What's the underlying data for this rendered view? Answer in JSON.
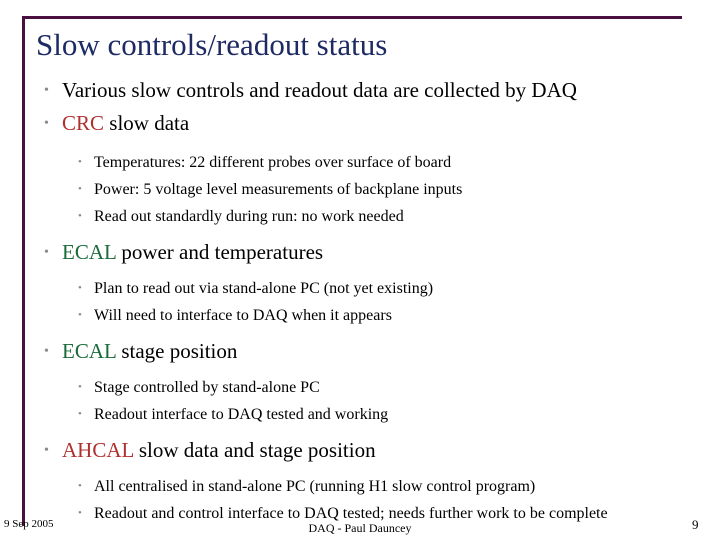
{
  "slide": {
    "title": "Slow controls/readout status",
    "accent_border_color": "#4a1040",
    "title_color": "#1d2a63",
    "highlight_red": "#b03030",
    "highlight_green": "#1b6b3a",
    "bullet_glyph": "•",
    "content": [
      {
        "level": 1,
        "text": "Various slow controls and readout data are collected by DAQ",
        "highlight": null
      },
      {
        "level": 1,
        "highlight": "CRC",
        "highlight_color": "#b03030",
        "text": " slow data"
      },
      {
        "level": 2,
        "text": "Temperatures: 22 different probes over surface of board"
      },
      {
        "level": 2,
        "text": "Power: 5 voltage level measurements of backplane inputs"
      },
      {
        "level": 2,
        "text": "Read out standardly during run: no work needed"
      },
      {
        "level": 1,
        "highlight": "ECAL",
        "highlight_color": "#1b6b3a",
        "text": " power and temperatures"
      },
      {
        "level": 2,
        "text": "Plan to read out via stand-alone PC (not yet existing)"
      },
      {
        "level": 2,
        "text": "Will need to interface to DAQ when it appears"
      },
      {
        "level": 1,
        "highlight": "ECAL",
        "highlight_color": "#1b6b3a",
        "text": " stage position"
      },
      {
        "level": 2,
        "text": "Stage controlled by stand-alone PC"
      },
      {
        "level": 2,
        "text": "Readout interface to DAQ tested and working"
      },
      {
        "level": 1,
        "highlight": "AHCAL",
        "highlight_color": "#b03030",
        "text": " slow data and stage position"
      },
      {
        "level": 2,
        "text": "All centralised in stand-alone PC (running H1 slow control program)"
      },
      {
        "level": 2,
        "text": "Readout and control interface to DAQ tested; needs further work to be complete"
      }
    ]
  },
  "footer": {
    "date": "9 Sep 2005",
    "center": "DAQ - Paul Dauncey",
    "page_number": "9"
  }
}
